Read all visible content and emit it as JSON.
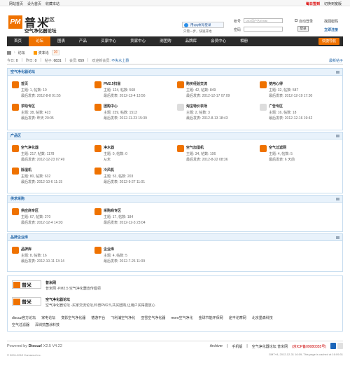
{
  "topbar": {
    "left": [
      "网站首页",
      "设为首页",
      "收藏本站"
    ],
    "right": [
      "每日签到",
      "切换到宽版"
    ]
  },
  "header": {
    "logo_text": "PM",
    "logo_cn": "普米",
    "logo_she": "社区",
    "logo_sub": "空气净化器论坛",
    "qq_button": "用QQ帐号登录",
    "qq_note": "只需一步，快速开始",
    "account_label": "帐号",
    "account_placeholder": "UID/用户名/Email",
    "password_label": "密码",
    "auto_login": "自动登录",
    "forgot": "找回密码",
    "login_button": "登录",
    "register": "立即注册"
  },
  "nav": {
    "items": [
      "首页",
      "论坛",
      "图表",
      "产品",
      "买家中心",
      "卖家中心",
      "测团购",
      "品牌库",
      "会员中心",
      "相册"
    ],
    "active_index": 1,
    "quick": "快捷导航"
  },
  "crumb": {
    "forum": "论坛",
    "rss": "资本论",
    "count": "20"
  },
  "stats": {
    "today_label": "今日:",
    "today": "0",
    "yesterday_label": "昨日:",
    "yesterday": "0",
    "posts_label": "帖子:",
    "posts": "6831",
    "members_label": "会员:",
    "members": "659",
    "welcome_label": "欢迎新会员:",
    "welcome": "不失水上爵",
    "newest": "最新帖子"
  },
  "sections": [
    {
      "title": "空气净化器论坛",
      "forums": [
        {
          "icon": "home-icon",
          "color": "#ef7200",
          "name": "首页",
          "l1": "主题: 1, 帖数: 10",
          "l2": "最后发表: 2012-8-8 01:55"
        },
        {
          "icon": "chart-icon",
          "color": "#ef7200",
          "name": "PM2.5扫盲",
          "l1": "主题: 124, 帖数: 568",
          "l2": "最后发表: 2012-12-4 13:56"
        },
        {
          "icon": "chat-icon",
          "color": "#ef7200",
          "name": "购买经验交流",
          "l1": "主题: 42, 帖数: 849",
          "l2": "最后发表: 2012-12-17 07:09"
        },
        {
          "icon": "user-icon",
          "color": "#ef7200",
          "name": "使用心得",
          "l1": "主题: 32, 帖数: 587",
          "l2": "最后发表: 2012-12-19 17:30"
        },
        {
          "icon": "question-icon",
          "color": "#ef7200",
          "name": "求助专区",
          "l1": "主题: 38, 帖数: 423",
          "l2": "最后发表: 昨天 20:05"
        },
        {
          "icon": "group-buy-icon",
          "color": "#ef7200",
          "name": "团购中心",
          "l1": "主题: 239, 帖数: 1513",
          "l2": "最后发表: 2012-11-23 15:39"
        },
        {
          "icon": "bubble-icon",
          "color": "#ddd",
          "name": "淘宝特价表场",
          "l1": "主题: 2, 帖数: 3",
          "l2": "最后发表: 2012-8-13 18:43"
        },
        {
          "icon": "bubble-icon",
          "color": "#ddd",
          "name": "广告专区",
          "l1": "主题: 16, 帖数: 18",
          "l2": "最后发表: 2012-12-16 19:42"
        }
      ]
    },
    {
      "title": "产品区",
      "forums": [
        {
          "icon": "purifier-icon",
          "color": "#ef7200",
          "name": "空气净化器",
          "l1": "主题: 217, 帖数: 1178",
          "l2": "最后发表: 2012-12-23 07:49"
        },
        {
          "icon": "water-icon",
          "color": "#ef7200",
          "name": "净水器",
          "l1": "主题: 0, 帖数: 0",
          "l2": "从未"
        },
        {
          "icon": "humidifier-icon",
          "color": "#ef7200",
          "name": "空气加湿机",
          "l1": "主题: 34, 帖数: 106",
          "l2": "最后发表: 2012-8-22 08:36"
        },
        {
          "icon": "filter-icon",
          "color": "#ef7200",
          "name": "空气过滤网",
          "l1": "主题: 4, 帖数: 5",
          "l2": "最后发表: 6 天前"
        },
        {
          "icon": "dehumidifier-icon",
          "color": "#ef7200",
          "name": "除湿机",
          "l1": "主题: 80, 帖数: 632",
          "l2": "最后发表: 2012-10-6 11:15"
        },
        {
          "icon": "fan-icon",
          "color": "#ef7200",
          "name": "冷风机",
          "l1": "主题: 53, 帖数: 203",
          "l2": "最后发表: 2012-9-27 11:01"
        }
      ]
    },
    {
      "title": "供求采购",
      "forums": [
        {
          "icon": "supply-icon",
          "color": "#ef7200",
          "name": "供应商专区",
          "l1": "主题: 67, 帖数: 270",
          "l2": "最后发表: 2012-12-4 14:03"
        },
        {
          "icon": "buyer-icon",
          "color": "#ef7200",
          "name": "采购商专区",
          "l1": "主题: 17, 帖数: 184",
          "l2": "最后发表: 2012-12-3 23:04"
        }
      ]
    },
    {
      "title": "品牌企业库",
      "forums": [
        {
          "icon": "brand-icon",
          "color": "#ef7200",
          "name": "品牌库",
          "l1": "主题: 8, 帖数: 16",
          "l2": "最后发表: 2012-10-11 13:14"
        },
        {
          "icon": "company-icon",
          "color": "#ef7200",
          "name": "企业库",
          "l1": "主题: 4, 帖数: 5",
          "l2": "最后发表: 2012-7-26 11:09"
        }
      ]
    }
  ],
  "links": {
    "items": [
      {
        "name": "普米网",
        "desc": "普米网 -PM2.5 空气净化器宣传倡领"
      },
      {
        "name": "空气净化器论坛",
        "desc": "空气净化器论坛 -买家交流论坛,科普PM2.5,共买团购,让用户买得更放心"
      }
    ],
    "text_row1": [
      "discuz官方论坛",
      "家电论坛",
      "变影空气净化器",
      "德游平台",
      "飞利浦空气净化",
      "亚雪空气净化器",
      "moro空气净化",
      "金球节能环保网",
      "途丰论摩网",
      "北京墨森科技"
    ],
    "text_row2": [
      "空气过滤器",
      "深圳抗菌涂料技"
    ]
  },
  "footer": {
    "powered": "Powered by",
    "discuz": "Discuz!",
    "version": "X2.5 V4.22",
    "copyright": "© 2001-2012 Comsenz Inc.",
    "links": [
      "Archiver",
      "手机版",
      "空气净化器论坛 普米网",
      "(京ICP备09080355号)"
    ],
    "gmt": "GMT+8, 2012-12-31 16:09, This page is cached at 16:09:31"
  }
}
